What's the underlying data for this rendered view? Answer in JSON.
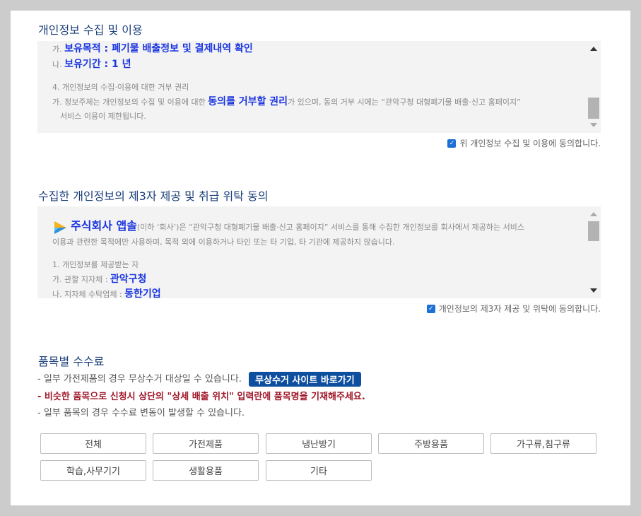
{
  "section1": {
    "title": "개인정보 수집 및 이용",
    "line_a_prefix": "가.",
    "line_a_value": "보유목적 : 폐기물 배출정보 및 결제내역 확인",
    "line_b_prefix": "나.",
    "line_b_value": "보유기간 : 1 년",
    "item4_heading": "4. 개인정보의 수집·이용에 대한 거부 권리",
    "item4_a_start": "가. 정보주체는 개인정보의 수집 및 이용에 대한 ",
    "item4_a_strong": "동의를 거부할 권리",
    "item4_a_end": "가 있으며, 동의 거부 시에는 “관악구청 대형폐기물 배출·신고 홈페이지”",
    "item4_a_cont": "서비스 이용이 제한됩니다.",
    "agree_label": "위 개인정보 수집 및 이용에 동의합니다.",
    "agree_checked": true
  },
  "section2": {
    "title": "수집한 개인정보의 제3자 제공 및 취급 위탁 동의",
    "company_name": "주식회사 앱솔",
    "intro_rest": "(이하 ‘회사’)은 “관악구청 대형폐기물 배출·신고 홈페이지” 서비스를 통해 수집한 개인정보를 회사에서 제공하는 서비스",
    "intro_cont": "이용과 관련한 목적에만 사용하며, 목적 외에 이용하거나 타인 또는 타 기업, 타 기관에 제공하지 않습니다.",
    "item1_heading": "1. 개인정보를 제공받는 자",
    "item1_a_prefix": "가. 관할 지자체 : ",
    "item1_a_value": "관악구청",
    "item1_b_prefix": "나. 지자체 수탁업체 : ",
    "item1_b_value": "동한기업",
    "agree_label": "개인정보의 제3자 제공 및 위탁에 동의합니다.",
    "agree_checked": true
  },
  "fees": {
    "title": "품목별 수수료",
    "line1": "- 일부 가전제품의 경우 무상수거 대상일 수 있습니다.",
    "free_pickup_button": "무상수거 사이트 바로가기",
    "line2": "- 비슷한 품목으로 신청시 상단의 \"상세 배출 위치\" 입력란에 품목명을 기재해주세요.",
    "line3": "- 일부 품목의 경우 수수료 변동이 발생할 수 있습니다.",
    "categories": [
      "전체",
      "가전제품",
      "냉난방기",
      "주방용품",
      "가구류,침구류",
      "학습,사무기기",
      "생활용품",
      "기타"
    ]
  },
  "icons": {
    "scroll_up": "arrow-up-icon",
    "scroll_down": "arrow-down-icon",
    "checkbox": "checkmark-icon",
    "logo": "absol-logo-icon"
  },
  "colors": {
    "title": "#1b3f7a",
    "strong_text": "#1a35e0",
    "warning": "#a0182a",
    "button_bg": "#0d4f9e",
    "checkbox": "#1c6fd4"
  }
}
